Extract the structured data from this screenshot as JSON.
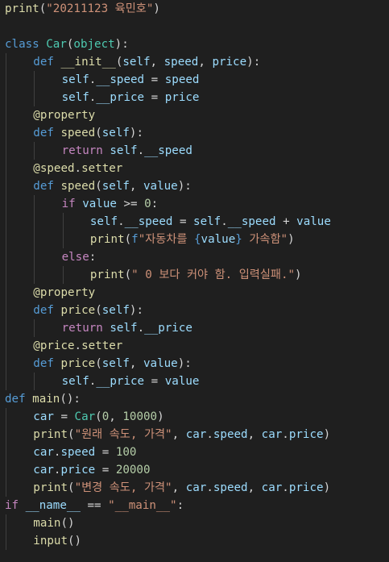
{
  "colors": {
    "background": "#1f1f1f",
    "plain": "#d4d4d4",
    "keyword": "#569cd6",
    "control": "#c586c0",
    "function": "#dcdcaa",
    "class": "#4ec9b0",
    "variable": "#9cdcfe",
    "string": "#ce9178",
    "number": "#b5cea8",
    "indent_guide": "#404040"
  },
  "editor": {
    "lines": [
      {
        "indent": 0,
        "tokens": [
          {
            "t": "print",
            "k": "function"
          },
          {
            "t": "(",
            "k": "plain"
          },
          {
            "t": "\"20211123 육민호\"",
            "k": "string"
          },
          {
            "t": ")",
            "k": "plain"
          }
        ]
      },
      {
        "indent": 0,
        "tokens": []
      },
      {
        "indent": 0,
        "tokens": [
          {
            "t": "class ",
            "k": "keyword"
          },
          {
            "t": "Car",
            "k": "class"
          },
          {
            "t": "(",
            "k": "plain"
          },
          {
            "t": "object",
            "k": "class"
          },
          {
            "t": "):",
            "k": "plain"
          }
        ]
      },
      {
        "indent": 1,
        "tokens": [
          {
            "t": "def ",
            "k": "keyword"
          },
          {
            "t": "__init__",
            "k": "function"
          },
          {
            "t": "(",
            "k": "plain"
          },
          {
            "t": "self",
            "k": "variable"
          },
          {
            "t": ", ",
            "k": "plain"
          },
          {
            "t": "speed",
            "k": "variable"
          },
          {
            "t": ", ",
            "k": "plain"
          },
          {
            "t": "price",
            "k": "variable"
          },
          {
            "t": "):",
            "k": "plain"
          }
        ]
      },
      {
        "indent": 2,
        "tokens": [
          {
            "t": "self",
            "k": "variable"
          },
          {
            "t": ".",
            "k": "plain"
          },
          {
            "t": "__speed",
            "k": "variable"
          },
          {
            "t": " = ",
            "k": "plain"
          },
          {
            "t": "speed",
            "k": "variable"
          }
        ]
      },
      {
        "indent": 2,
        "tokens": [
          {
            "t": "self",
            "k": "variable"
          },
          {
            "t": ".",
            "k": "plain"
          },
          {
            "t": "__price",
            "k": "variable"
          },
          {
            "t": " = ",
            "k": "plain"
          },
          {
            "t": "price",
            "k": "variable"
          }
        ]
      },
      {
        "indent": 1,
        "tokens": [
          {
            "t": "@property",
            "k": "function"
          }
        ]
      },
      {
        "indent": 1,
        "tokens": [
          {
            "t": "def ",
            "k": "keyword"
          },
          {
            "t": "speed",
            "k": "function"
          },
          {
            "t": "(",
            "k": "plain"
          },
          {
            "t": "self",
            "k": "variable"
          },
          {
            "t": "):",
            "k": "plain"
          }
        ]
      },
      {
        "indent": 2,
        "tokens": [
          {
            "t": "return ",
            "k": "control"
          },
          {
            "t": "self",
            "k": "variable"
          },
          {
            "t": ".",
            "k": "plain"
          },
          {
            "t": "__speed",
            "k": "variable"
          }
        ]
      },
      {
        "indent": 1,
        "tokens": [
          {
            "t": "@speed",
            "k": "function"
          },
          {
            "t": ".",
            "k": "plain"
          },
          {
            "t": "setter",
            "k": "function"
          }
        ]
      },
      {
        "indent": 1,
        "tokens": [
          {
            "t": "def ",
            "k": "keyword"
          },
          {
            "t": "speed",
            "k": "function"
          },
          {
            "t": "(",
            "k": "plain"
          },
          {
            "t": "self",
            "k": "variable"
          },
          {
            "t": ", ",
            "k": "plain"
          },
          {
            "t": "value",
            "k": "variable"
          },
          {
            "t": "):",
            "k": "plain"
          }
        ]
      },
      {
        "indent": 2,
        "tokens": [
          {
            "t": "if ",
            "k": "control"
          },
          {
            "t": "value",
            "k": "variable"
          },
          {
            "t": " >= ",
            "k": "plain"
          },
          {
            "t": "0",
            "k": "number"
          },
          {
            "t": ":",
            "k": "plain"
          }
        ]
      },
      {
        "indent": 3,
        "tokens": [
          {
            "t": "self",
            "k": "variable"
          },
          {
            "t": ".",
            "k": "plain"
          },
          {
            "t": "__speed",
            "k": "variable"
          },
          {
            "t": " = ",
            "k": "plain"
          },
          {
            "t": "self",
            "k": "variable"
          },
          {
            "t": ".",
            "k": "plain"
          },
          {
            "t": "__speed",
            "k": "variable"
          },
          {
            "t": " + ",
            "k": "plain"
          },
          {
            "t": "value",
            "k": "variable"
          }
        ]
      },
      {
        "indent": 3,
        "tokens": [
          {
            "t": "print",
            "k": "function"
          },
          {
            "t": "(",
            "k": "plain"
          },
          {
            "t": "f",
            "k": "keyword"
          },
          {
            "t": "\"자동차를 ",
            "k": "string"
          },
          {
            "t": "{",
            "k": "keyword"
          },
          {
            "t": "value",
            "k": "variable"
          },
          {
            "t": "}",
            "k": "keyword"
          },
          {
            "t": " 가속함\"",
            "k": "string"
          },
          {
            "t": ")",
            "k": "plain"
          }
        ]
      },
      {
        "indent": 2,
        "tokens": [
          {
            "t": "else",
            "k": "control"
          },
          {
            "t": ":",
            "k": "plain"
          }
        ]
      },
      {
        "indent": 3,
        "tokens": [
          {
            "t": "print",
            "k": "function"
          },
          {
            "t": "(",
            "k": "plain"
          },
          {
            "t": "\" 0 보다 커야 함. 입력실패.\"",
            "k": "string"
          },
          {
            "t": ")",
            "k": "plain"
          }
        ]
      },
      {
        "indent": 1,
        "tokens": [
          {
            "t": "@property",
            "k": "function"
          }
        ]
      },
      {
        "indent": 1,
        "tokens": [
          {
            "t": "def ",
            "k": "keyword"
          },
          {
            "t": "price",
            "k": "function"
          },
          {
            "t": "(",
            "k": "plain"
          },
          {
            "t": "self",
            "k": "variable"
          },
          {
            "t": "):",
            "k": "plain"
          }
        ]
      },
      {
        "indent": 2,
        "tokens": [
          {
            "t": "return ",
            "k": "control"
          },
          {
            "t": "self",
            "k": "variable"
          },
          {
            "t": ".",
            "k": "plain"
          },
          {
            "t": "__price",
            "k": "variable"
          }
        ]
      },
      {
        "indent": 1,
        "tokens": [
          {
            "t": "@price",
            "k": "function"
          },
          {
            "t": ".",
            "k": "plain"
          },
          {
            "t": "setter",
            "k": "function"
          }
        ]
      },
      {
        "indent": 1,
        "tokens": [
          {
            "t": "def ",
            "k": "keyword"
          },
          {
            "t": "price",
            "k": "function"
          },
          {
            "t": "(",
            "k": "plain"
          },
          {
            "t": "self",
            "k": "variable"
          },
          {
            "t": ", ",
            "k": "plain"
          },
          {
            "t": "value",
            "k": "variable"
          },
          {
            "t": "):",
            "k": "plain"
          }
        ]
      },
      {
        "indent": 2,
        "tokens": [
          {
            "t": "self",
            "k": "variable"
          },
          {
            "t": ".",
            "k": "plain"
          },
          {
            "t": "__price",
            "k": "variable"
          },
          {
            "t": " = ",
            "k": "plain"
          },
          {
            "t": "value",
            "k": "variable"
          }
        ]
      },
      {
        "indent": 0,
        "tokens": [
          {
            "t": "def ",
            "k": "keyword"
          },
          {
            "t": "main",
            "k": "function"
          },
          {
            "t": "():",
            "k": "plain"
          }
        ]
      },
      {
        "indent": 1,
        "tokens": [
          {
            "t": "car",
            "k": "variable"
          },
          {
            "t": " = ",
            "k": "plain"
          },
          {
            "t": "Car",
            "k": "class"
          },
          {
            "t": "(",
            "k": "plain"
          },
          {
            "t": "0",
            "k": "number"
          },
          {
            "t": ", ",
            "k": "plain"
          },
          {
            "t": "10000",
            "k": "number"
          },
          {
            "t": ")",
            "k": "plain"
          }
        ]
      },
      {
        "indent": 1,
        "tokens": [
          {
            "t": "print",
            "k": "function"
          },
          {
            "t": "(",
            "k": "plain"
          },
          {
            "t": "\"원래 속도, 가격\"",
            "k": "string"
          },
          {
            "t": ", ",
            "k": "plain"
          },
          {
            "t": "car",
            "k": "variable"
          },
          {
            "t": ".",
            "k": "plain"
          },
          {
            "t": "speed",
            "k": "variable"
          },
          {
            "t": ", ",
            "k": "plain"
          },
          {
            "t": "car",
            "k": "variable"
          },
          {
            "t": ".",
            "k": "plain"
          },
          {
            "t": "price",
            "k": "variable"
          },
          {
            "t": ")",
            "k": "plain"
          }
        ]
      },
      {
        "indent": 1,
        "tokens": [
          {
            "t": "car",
            "k": "variable"
          },
          {
            "t": ".",
            "k": "plain"
          },
          {
            "t": "speed",
            "k": "variable"
          },
          {
            "t": " = ",
            "k": "plain"
          },
          {
            "t": "100",
            "k": "number"
          }
        ]
      },
      {
        "indent": 1,
        "tokens": [
          {
            "t": "car",
            "k": "variable"
          },
          {
            "t": ".",
            "k": "plain"
          },
          {
            "t": "price",
            "k": "variable"
          },
          {
            "t": " = ",
            "k": "plain"
          },
          {
            "t": "20000",
            "k": "number"
          }
        ]
      },
      {
        "indent": 1,
        "tokens": [
          {
            "t": "print",
            "k": "function"
          },
          {
            "t": "(",
            "k": "plain"
          },
          {
            "t": "\"변경 속도, 가격\"",
            "k": "string"
          },
          {
            "t": ", ",
            "k": "plain"
          },
          {
            "t": "car",
            "k": "variable"
          },
          {
            "t": ".",
            "k": "plain"
          },
          {
            "t": "speed",
            "k": "variable"
          },
          {
            "t": ", ",
            "k": "plain"
          },
          {
            "t": "car",
            "k": "variable"
          },
          {
            "t": ".",
            "k": "plain"
          },
          {
            "t": "price",
            "k": "variable"
          },
          {
            "t": ")",
            "k": "plain"
          }
        ]
      },
      {
        "indent": 0,
        "tokens": [
          {
            "t": "if ",
            "k": "control"
          },
          {
            "t": "__name__",
            "k": "variable"
          },
          {
            "t": " == ",
            "k": "plain"
          },
          {
            "t": "\"__main__\"",
            "k": "string"
          },
          {
            "t": ":",
            "k": "plain"
          }
        ]
      },
      {
        "indent": 1,
        "tokens": [
          {
            "t": "main",
            "k": "function"
          },
          {
            "t": "()",
            "k": "plain"
          }
        ]
      },
      {
        "indent": 1,
        "tokens": [
          {
            "t": "input",
            "k": "function"
          },
          {
            "t": "()",
            "k": "plain"
          }
        ]
      }
    ]
  }
}
